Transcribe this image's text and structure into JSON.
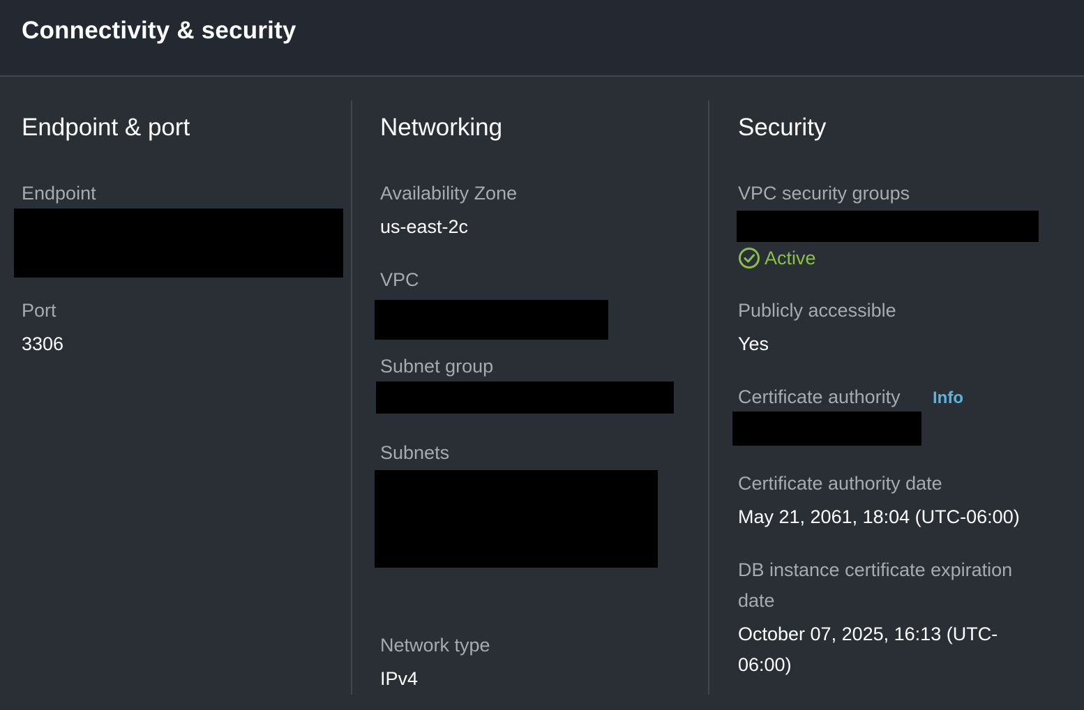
{
  "header": {
    "title": "Connectivity & security"
  },
  "endpoint_port": {
    "title": "Endpoint & port",
    "endpoint_label": "Endpoint",
    "port_label": "Port",
    "port_value": "3306"
  },
  "networking": {
    "title": "Networking",
    "az_label": "Availability Zone",
    "az_value": "us-east-2c",
    "vpc_label": "VPC",
    "subnet_group_label": "Subnet group",
    "subnets_label": "Subnets",
    "network_type_label": "Network type",
    "network_type_value": "IPv4"
  },
  "security": {
    "title": "Security",
    "vpc_sg_label": "VPC security groups",
    "sg_status": "Active",
    "public_label": "Publicly accessible",
    "public_value": "Yes",
    "ca_label": "Certificate authority",
    "ca_info": "Info",
    "ca_date_label": "Certificate authority date",
    "ca_date_value": "May 21, 2061, 18:04 (UTC-06:00)",
    "cert_exp_label_line1": "DB instance certificate expiration",
    "cert_exp_label_line2": "date",
    "cert_exp_value_line1": "October 07, 2025, 16:13 (UTC-",
    "cert_exp_value_line2": "06:00)"
  },
  "colors": {
    "background": "#2a2e35",
    "header_bg": "#232831",
    "status_active": "#86c24a",
    "link": "#5ab4e0"
  },
  "icons": {
    "status": "check-circle-icon"
  }
}
